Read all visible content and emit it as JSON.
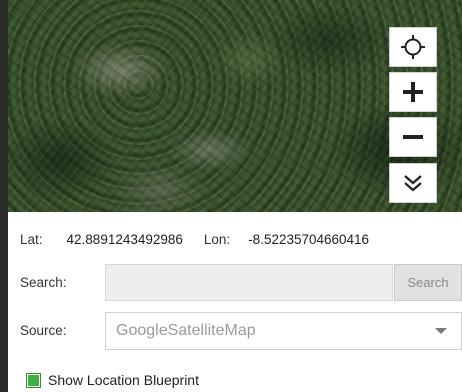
{
  "map": {
    "controls": [
      {
        "name": "locate-icon"
      },
      {
        "name": "zoom-in-icon"
      },
      {
        "name": "zoom-out-icon"
      },
      {
        "name": "collapse-icon"
      }
    ]
  },
  "coords": {
    "lat_label": "Lat:",
    "lat_value": "42.8891243492986",
    "lon_label": "Lon:",
    "lon_value": "-8.52235704660416"
  },
  "search": {
    "label": "Search:",
    "value": "",
    "button": "Search"
  },
  "source": {
    "label": "Source:",
    "selected": "GoogleSatelliteMap"
  },
  "blueprint": {
    "label": "Show Location Blueprint",
    "checked": true,
    "accent": "#3cb043"
  }
}
